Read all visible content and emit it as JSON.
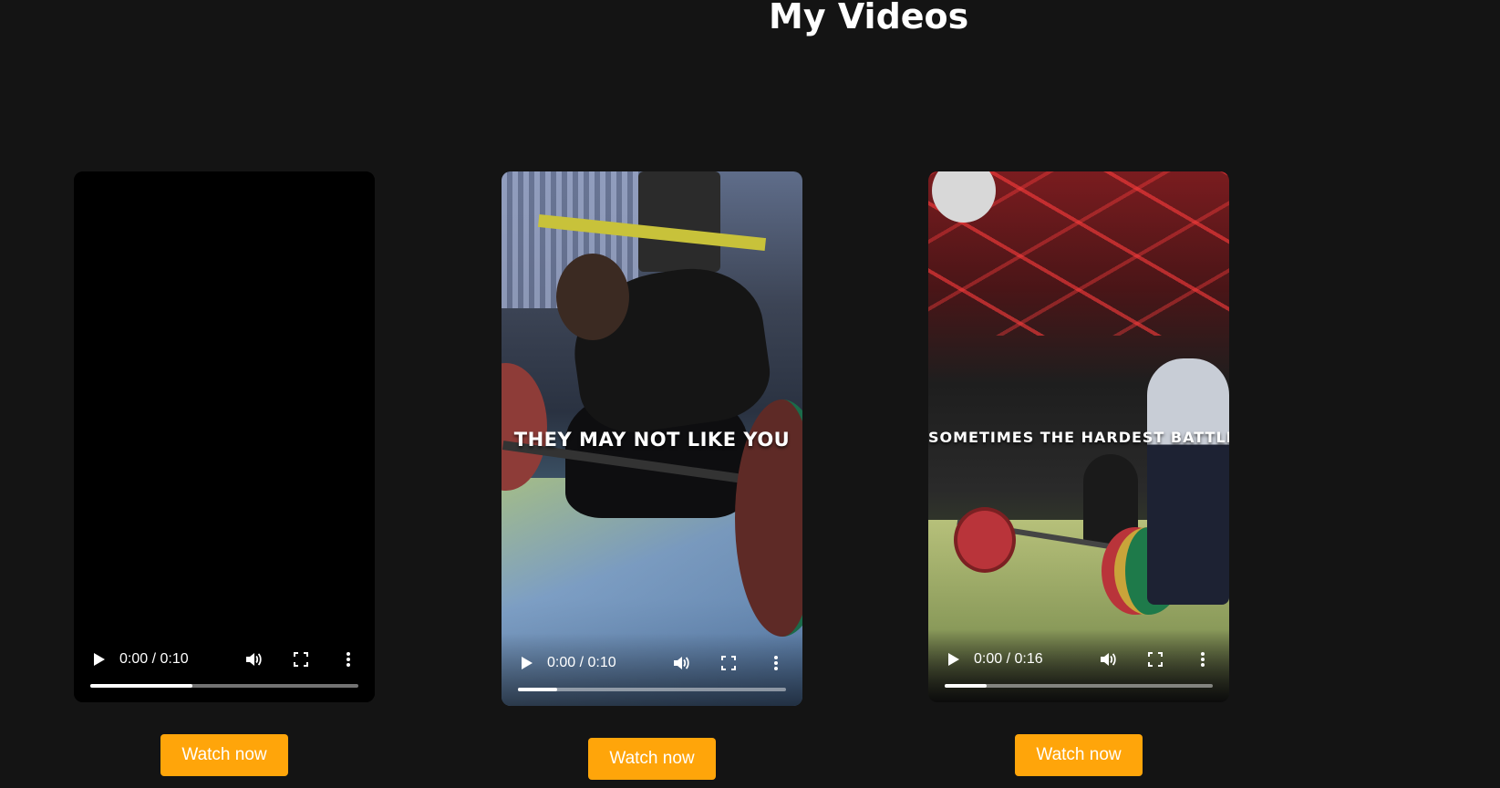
{
  "page": {
    "title": "My Videos",
    "accent_color": "#ffa50a",
    "background_color": "#141414"
  },
  "videos": [
    {
      "caption": "",
      "time": "0:00 / 0:10",
      "progress_buffered": 0.38,
      "button_label": "Watch now"
    },
    {
      "caption": "THEY MAY NOT LIKE YOU",
      "time": "0:00 / 0:10",
      "progress_buffered": 0.145,
      "button_label": "Watch now"
    },
    {
      "caption": "SOMETIMES  THE  HARDEST  BATTLE",
      "time": "0:00 / 0:16",
      "progress_buffered": 0.155,
      "button_label": "Watch now"
    }
  ],
  "icons": {
    "play": "play-icon",
    "volume": "volume-icon",
    "fullscreen": "fullscreen-icon",
    "more": "more-options-icon"
  }
}
